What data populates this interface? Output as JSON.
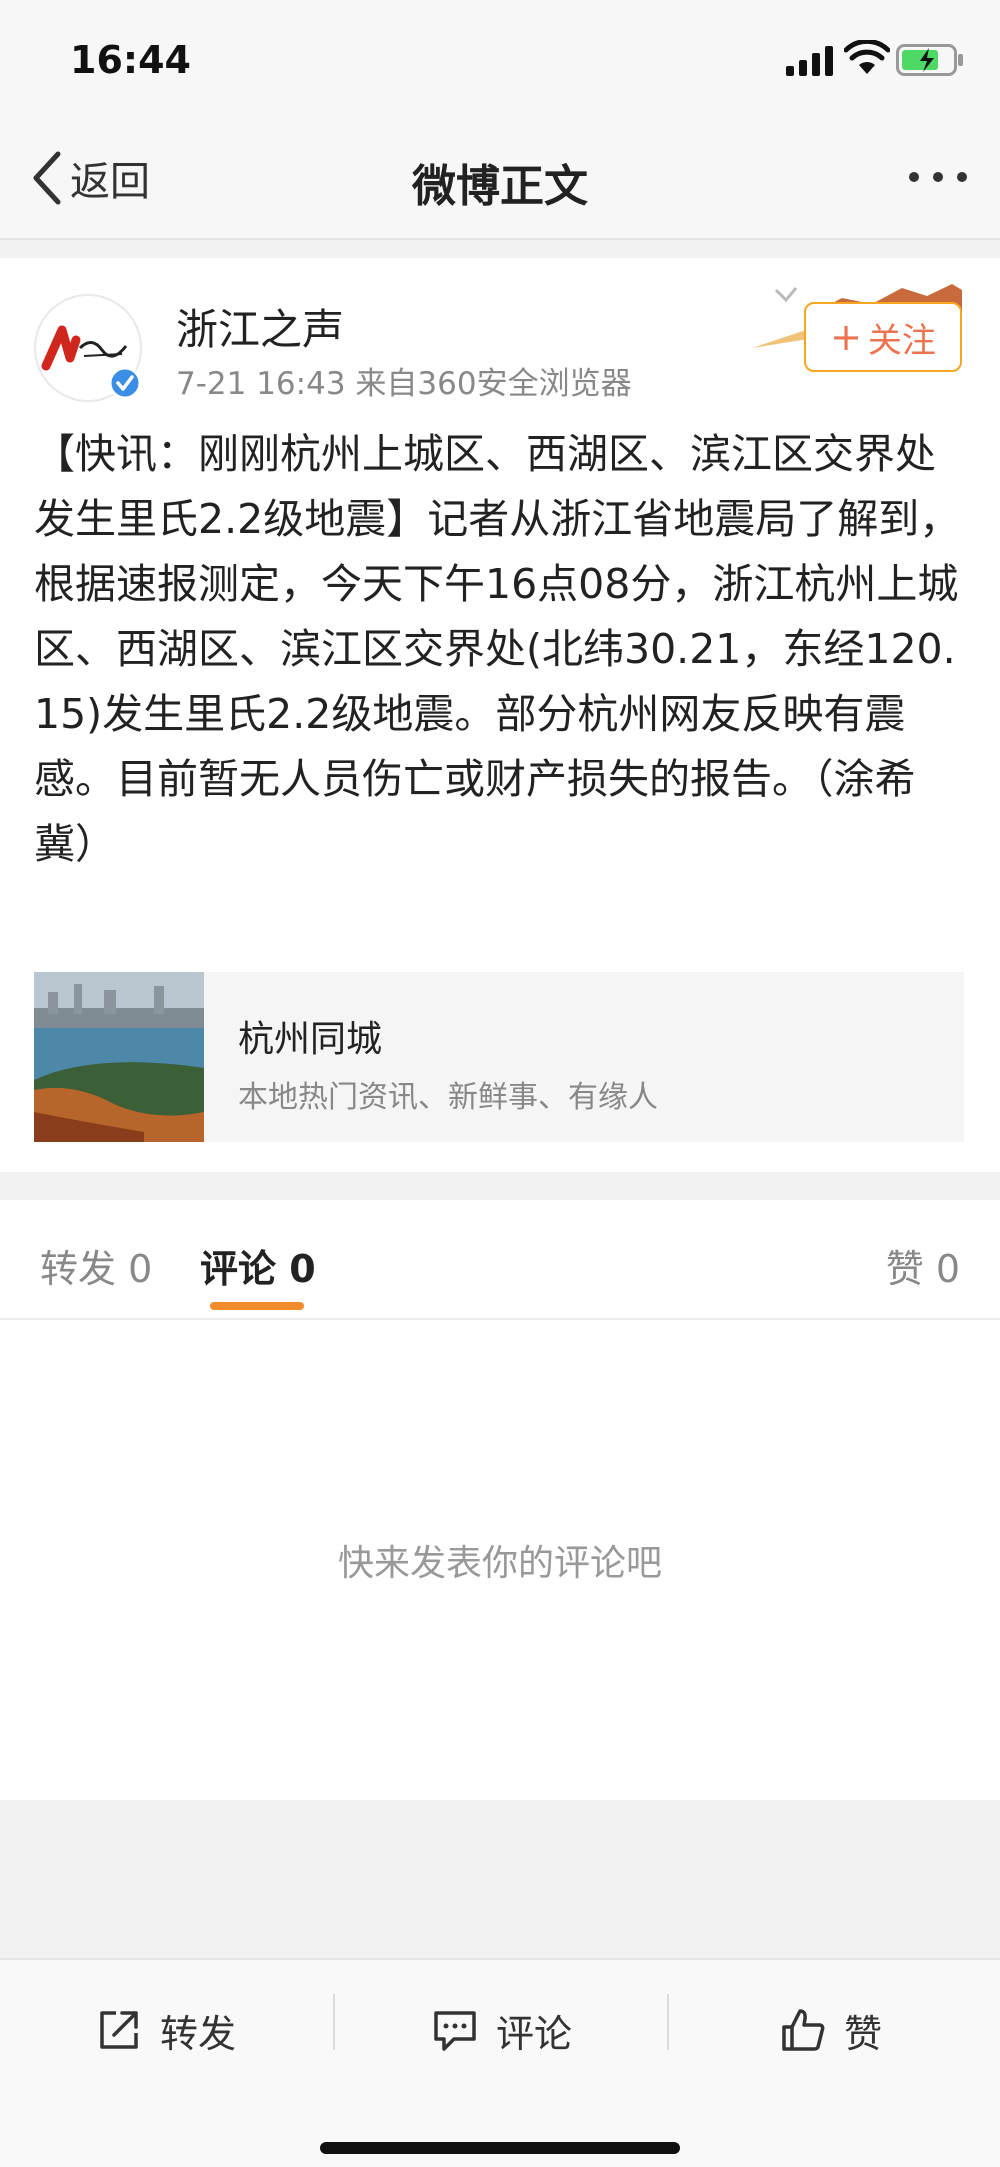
{
  "status_bar": {
    "time": "16:44"
  },
  "nav": {
    "back_label": "返回",
    "title": "微博正文"
  },
  "post": {
    "author": "浙江之声",
    "meta": "7-21 16:43  来自360安全浏览器",
    "follow_label": "关注",
    "content": "【快讯：刚刚杭州上城区、西湖区、滨江区交界处发生里氏2.2级地震】记者从浙江省地震局了解到，根据速报测定，今天下午16点08分，浙江杭州上城区、西湖区、滨江区交界处(北纬30.21，东经120.15)发生里氏2.2级地震。部分杭州网友反映有震感。目前暂无人员伤亡或财产损失的报告。（涂希冀）",
    "share_card": {
      "title": "杭州同城",
      "subtitle": "本地热门资讯、新鲜事、有缘人"
    }
  },
  "tabs": {
    "repost": "转发 0",
    "comment": "评论 0",
    "like": "赞 0",
    "active": "comment"
  },
  "comments": {
    "empty_text": "快来发表你的评论吧"
  },
  "bottom_bar": {
    "repost": "转发",
    "comment": "评论",
    "like": "赞"
  },
  "colors": {
    "accent": "#f28a2e",
    "follow_border": "#f5a623",
    "follow_text": "#eb7350",
    "verified": "#3a8ee6"
  },
  "icons": [
    "signal-icon",
    "wifi-icon",
    "battery-icon",
    "back-chevron-icon",
    "more-icon",
    "verified-icon",
    "plus-icon",
    "share-icon",
    "comment-icon",
    "like-icon"
  ]
}
